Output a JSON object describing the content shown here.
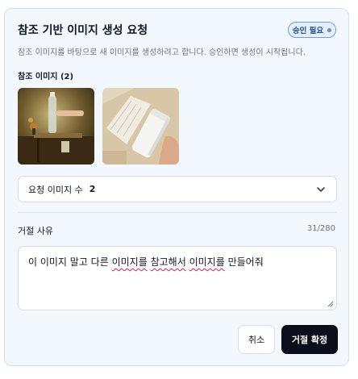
{
  "dialog": {
    "title": "참조 기반 이미지 생성 요청",
    "badge": "승인 필요",
    "description": "참조 이미지를 바탕으로 새 이미지를 생성하려고 합니다. 승인하면 생성이 시작됩니다.",
    "reference_label": "참조 이미지 (2)",
    "images": [
      {
        "icon": "reference-photo-bottle-on-table"
      },
      {
        "icon": "reference-photo-white-bottle"
      }
    ],
    "count_select": {
      "label": "요청 이미지 수",
      "value": "2"
    },
    "reason": {
      "label": "거절 사유",
      "counter": "31/280",
      "text_parts": [
        "이 이미지 말고 다른 ",
        "이미지를",
        " ",
        "참고해서",
        " ",
        "이미지를",
        " 만들어줘"
      ]
    },
    "buttons": {
      "cancel": "취소",
      "confirm": "거절 확정"
    }
  },
  "colors": {
    "card_bg": "#f3f8ff",
    "badge_border": "#6f9fd8",
    "confirm_bg": "#0b0f1a",
    "spell_underline": "#e11d48"
  }
}
